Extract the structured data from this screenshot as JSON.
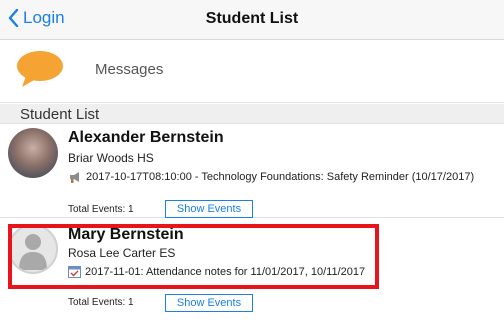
{
  "nav": {
    "back_label": "Login",
    "title": "Student List"
  },
  "messages": {
    "label": "Messages",
    "icon": "speech-bubble-icon",
    "icon_color": "#f5a433"
  },
  "section": {
    "title": "Student List"
  },
  "students": [
    {
      "name": "Alexander Bernstein",
      "school": "Briar Woods HS",
      "event_text": "2017-10-17T08:10:00 - Technology Foundations: Safety Reminder (10/17/2017)",
      "event_icon": "megaphone-icon",
      "total_events": "Total Events: 1",
      "button_label": "Show Events"
    },
    {
      "name": "Mary Bernstein",
      "school": "Rosa Lee Carter ES",
      "event_text": "2017-11-01: Attendance notes for 11/01/2017, 10/11/2017",
      "event_icon": "calendar-check-icon",
      "total_events": "Total Events: 1",
      "button_label": "Show Events"
    }
  ],
  "colors": {
    "accent": "#1a7fe6",
    "highlight": "#e8141c"
  }
}
